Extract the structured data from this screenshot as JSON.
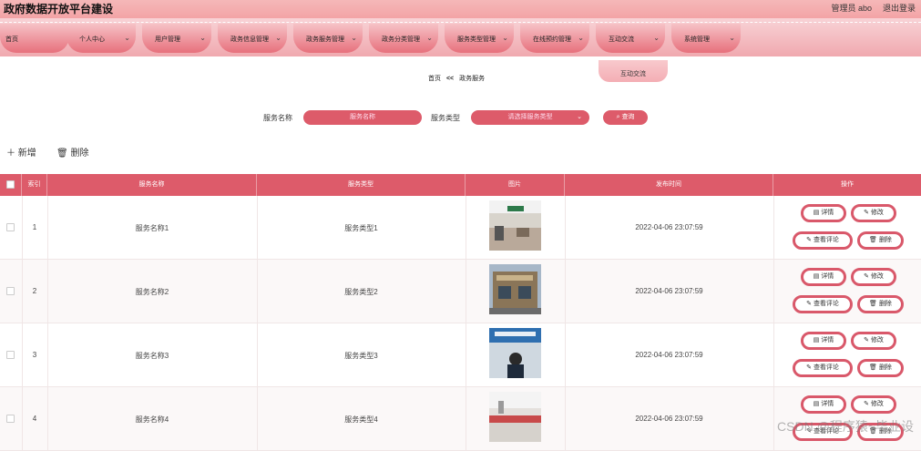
{
  "header": {
    "title": "政府数据开放平台建设",
    "admin": "管理员 abo",
    "logout": "退出登录"
  },
  "nav": [
    {
      "label": "首页",
      "chev": false
    },
    {
      "label": "个人中心",
      "chev": true
    },
    {
      "label": "用户管理",
      "chev": true
    },
    {
      "label": "政务信息管理",
      "chev": true
    },
    {
      "label": "政务服务管理",
      "chev": true
    },
    {
      "label": "政务分类管理",
      "chev": true
    },
    {
      "label": "服务类型管理",
      "chev": true
    },
    {
      "label": "在线预约管理",
      "chev": true
    },
    {
      "label": "互动交流",
      "chev": true
    },
    {
      "label": "系统管理",
      "chev": true
    }
  ],
  "dropdown_item": "互动交流",
  "breadcrumb": {
    "home": "首页",
    "sep": "<<",
    "current": "政务服务"
  },
  "search": {
    "name_label": "服务名称",
    "name_placeholder": "服务名称",
    "type_label": "服务类型",
    "type_placeholder": "请选择服务类型",
    "button": "查询"
  },
  "actions": {
    "add": "新增",
    "delete": "删除"
  },
  "table": {
    "headers": [
      "索引",
      "服务名称",
      "服务类型",
      "图片",
      "发布时间",
      "操作"
    ],
    "rows": [
      {
        "index": "1",
        "name": "服务名称1",
        "type": "服务类型1",
        "time": "2022-04-06 23:07:59"
      },
      {
        "index": "2",
        "name": "服务名称2",
        "type": "服务类型2",
        "time": "2022-04-06 23:07:59"
      },
      {
        "index": "3",
        "name": "服务名称3",
        "type": "服务类型3",
        "time": "2022-04-06 23:07:59"
      },
      {
        "index": "4",
        "name": "服务名称4",
        "type": "服务类型4",
        "time": "2022-04-06 23:07:59"
      }
    ],
    "op_labels": {
      "detail": "详情",
      "edit": "修改",
      "comments": "查看评论",
      "delete": "删除"
    }
  },
  "watermark": "CSDN @程序猿~毕业设",
  "colors": {
    "accent": "#dd5b6a",
    "header_bg": "#f3a3a6"
  }
}
